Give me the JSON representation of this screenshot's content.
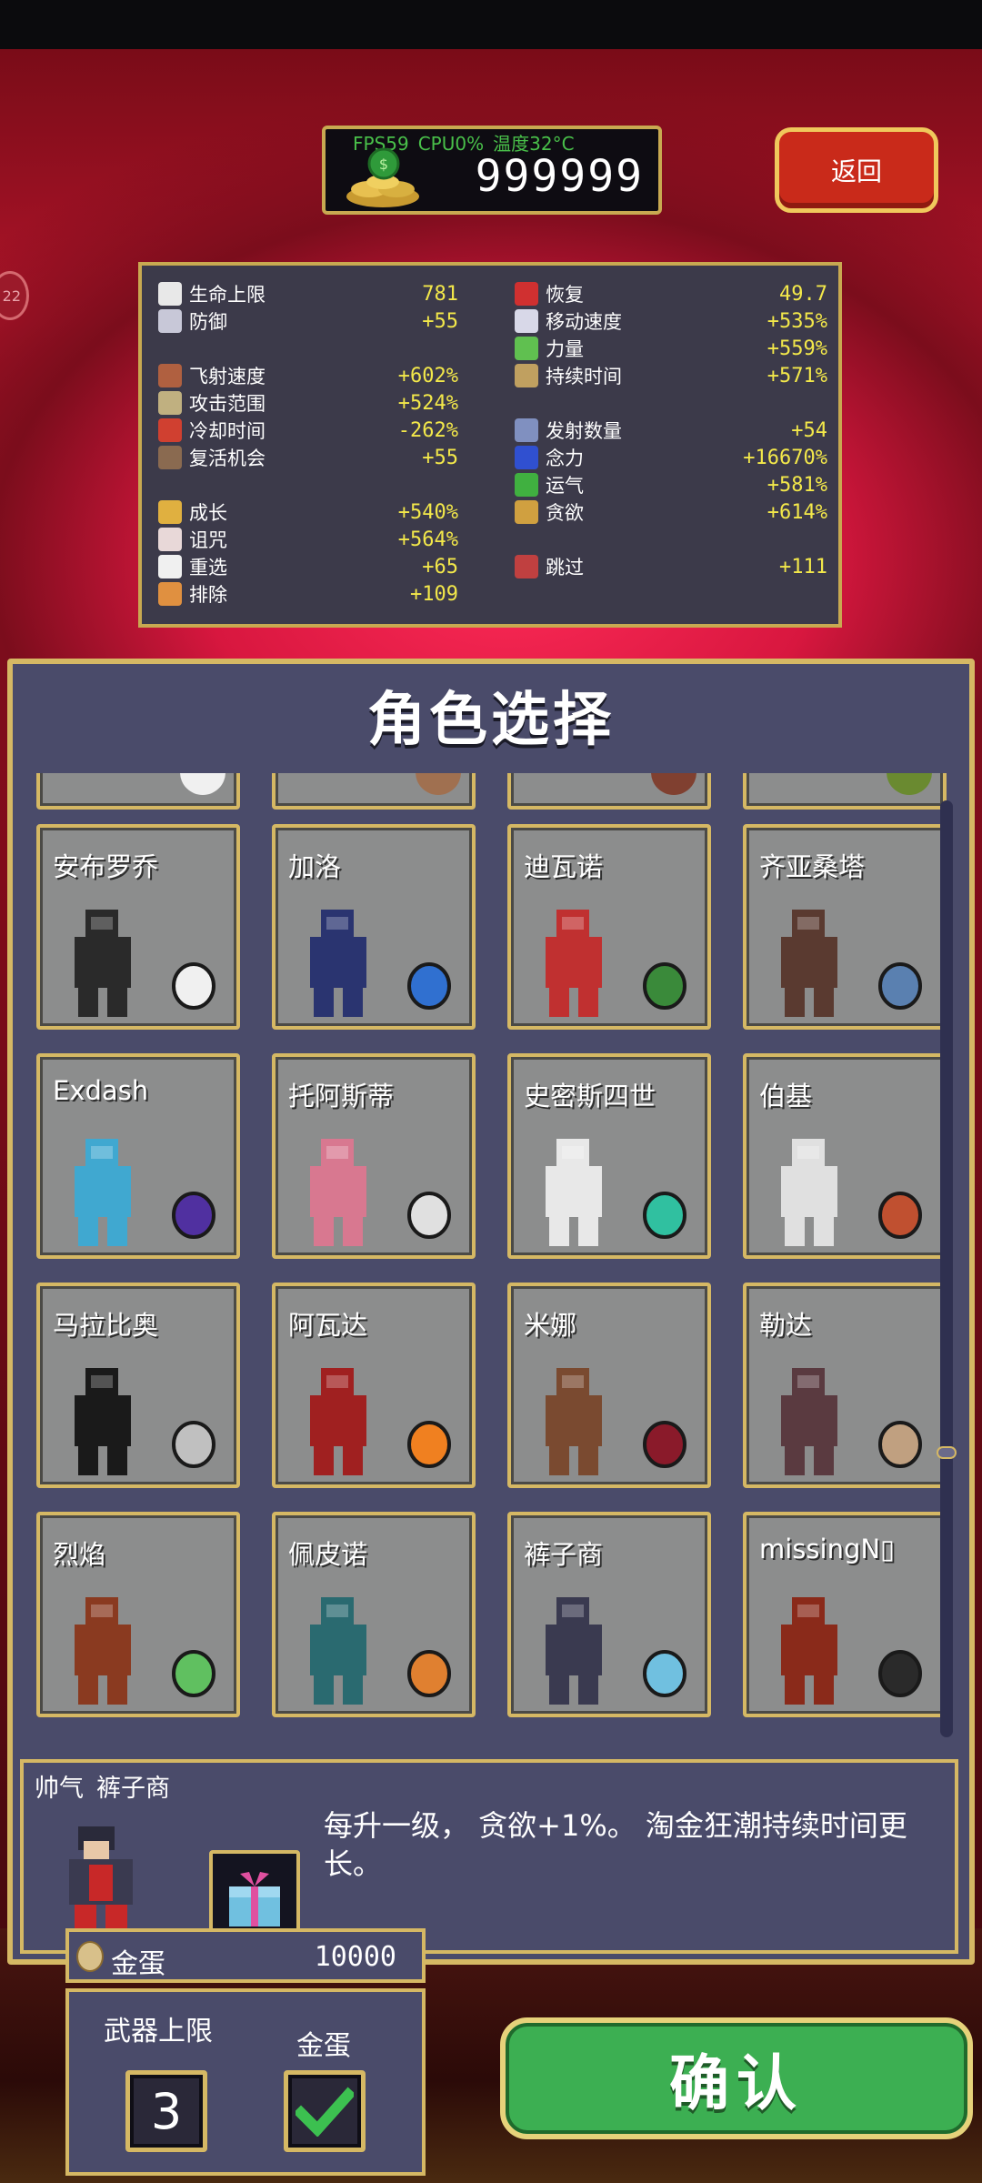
{
  "hud": {
    "fps": "FPS59",
    "cpu": "CPU0%",
    "temperature": "温度32°C",
    "coins": "999999",
    "back_label": "返回",
    "side_badge": "22"
  },
  "stats": {
    "left": [
      {
        "label": "生命上限",
        "value": "781",
        "icon": "heart-icon",
        "color": "#e8e8e8"
      },
      {
        "label": "防御",
        "value": "+55",
        "icon": "armor-icon",
        "color": "#c8c8d8"
      },
      {
        "label": "飞射速度",
        "value": "+602%",
        "icon": "speed-gauntlet-icon",
        "color": "#b06040"
      },
      {
        "label": "攻击范围",
        "value": "+524%",
        "icon": "area-icon",
        "color": "#c0b080"
      },
      {
        "label": "冷却时间",
        "value": "-262%",
        "icon": "cooldown-icon",
        "color": "#d04030"
      },
      {
        "label": "复活机会",
        "value": "+55",
        "icon": "revival-icon",
        "color": "#8a6a50"
      },
      {
        "label": "成长",
        "value": "+540%",
        "icon": "growth-crown-icon",
        "color": "#e0b040"
      },
      {
        "label": "诅咒",
        "value": "+564%",
        "icon": "curse-skull-icon",
        "color": "#e8d8d8"
      },
      {
        "label": "重选",
        "value": "+65",
        "icon": "reroll-dice-icon",
        "color": "#f0f0f0"
      },
      {
        "label": "排除",
        "value": "+109",
        "icon": "banish-hand-icon",
        "color": "#e09040"
      }
    ],
    "right": [
      {
        "label": "恢复",
        "value": "49.7",
        "icon": "recovery-heart-icon",
        "color": "#d03030"
      },
      {
        "label": "移动速度",
        "value": "+535%",
        "icon": "wing-icon",
        "color": "#d8d8e8"
      },
      {
        "label": "力量",
        "value": "+559%",
        "icon": "might-leaf-icon",
        "color": "#60c050"
      },
      {
        "label": "持续时间",
        "value": "+571%",
        "icon": "duration-hourglass-icon",
        "color": "#c0a060"
      },
      {
        "label": "发射数量",
        "value": "+54",
        "icon": "amount-icon",
        "color": "#8090c0"
      },
      {
        "label": "念力",
        "value": "+16670%",
        "icon": "magnet-orb-icon",
        "color": "#3050d0"
      },
      {
        "label": "运气",
        "value": "+581%",
        "icon": "clover-icon",
        "color": "#40b040"
      },
      {
        "label": "贪欲",
        "value": "+614%",
        "icon": "greed-mask-icon",
        "color": "#d0a040"
      },
      {
        "label": "跳过",
        "value": "+111",
        "icon": "skip-icon",
        "color": "#c04040"
      }
    ]
  },
  "panel": {
    "title": "角色选择"
  },
  "characters": [
    {
      "name": "安布罗乔",
      "char_color": "#2a2a2a",
      "weapon_color": "#f0f0f0",
      "weapon_icon": "egg-icon"
    },
    {
      "name": "加洛",
      "char_color": "#2a3470",
      "weapon_color": "#3070d0",
      "weapon_icon": "staff-icon"
    },
    {
      "name": "迪瓦诺",
      "char_color": "#c03030",
      "weapon_color": "#3a8a3a",
      "weapon_icon": "leaf-icon"
    },
    {
      "name": "齐亚桑塔",
      "char_color": "#5a3a30",
      "weapon_color": "#5a80b0",
      "weapon_icon": "ring-icon"
    },
    {
      "name": "Exdash",
      "char_color": "#40a8d0",
      "weapon_color": "#5030a0",
      "weapon_icon": "bird-icon"
    },
    {
      "name": "托阿斯蒂",
      "char_color": "#d87890",
      "weapon_color": "#e0e0e0",
      "weapon_icon": "bird-icon"
    },
    {
      "name": "史密斯四世",
      "char_color": "#e8e8e8",
      "weapon_color": "#30c0a0",
      "weapon_icon": "bird-icon"
    },
    {
      "name": "伯基",
      "char_color": "#e0e0e0",
      "weapon_color": "#c05030",
      "weapon_icon": "flower-icon"
    },
    {
      "name": "马拉比奥",
      "char_color": "#1a1a1a",
      "weapon_color": "#c0c0c0",
      "weapon_icon": "knives-icon"
    },
    {
      "name": "阿瓦达",
      "char_color": "#a02020",
      "weapon_color": "#f08020",
      "weapon_icon": "fire-icon"
    },
    {
      "name": "米娜",
      "char_color": "#7a4a30",
      "weapon_color": "#8a1a2a",
      "weapon_icon": "whip-icon"
    },
    {
      "name": "勒达",
      "char_color": "#5a3a40",
      "weapon_color": "#c0a080",
      "weapon_icon": "blob-icon"
    },
    {
      "name": "烈焰",
      "char_color": "#8a3a20",
      "weapon_color": "#60c060",
      "weapon_icon": "phoenix-icon"
    },
    {
      "name": "佩皮诺",
      "char_color": "#2a6a70",
      "weapon_color": "#e08030",
      "weapon_icon": "ornament-icon"
    },
    {
      "name": "裤子商",
      "char_color": "#3a3a50",
      "weapon_color": "#70c0e0",
      "weapon_icon": "gift-icon"
    },
    {
      "name": "missingN▯",
      "char_color": "#8a2a1a",
      "weapon_color": "#2a2a2a",
      "weapon_icon": "glitch-icon"
    }
  ],
  "top_row_partial": [
    {
      "weapon_color": "#f0f0f0"
    },
    {
      "weapon_color": "#a07050"
    },
    {
      "weapon_color": "#804030"
    },
    {
      "weapon_color": "#6a8a30"
    }
  ],
  "description": {
    "prefix": "帅气",
    "name": "裤子商",
    "text": "每升一级， 贪欲+1%。 淘金狂潮持续时间更长。"
  },
  "gold_egg": {
    "label": "金蛋",
    "value": "10000"
  },
  "options": {
    "weapon_limit_label": "武器上限",
    "weapon_limit_value": "3",
    "gold_egg_label": "金蛋"
  },
  "confirm_label": "确认"
}
